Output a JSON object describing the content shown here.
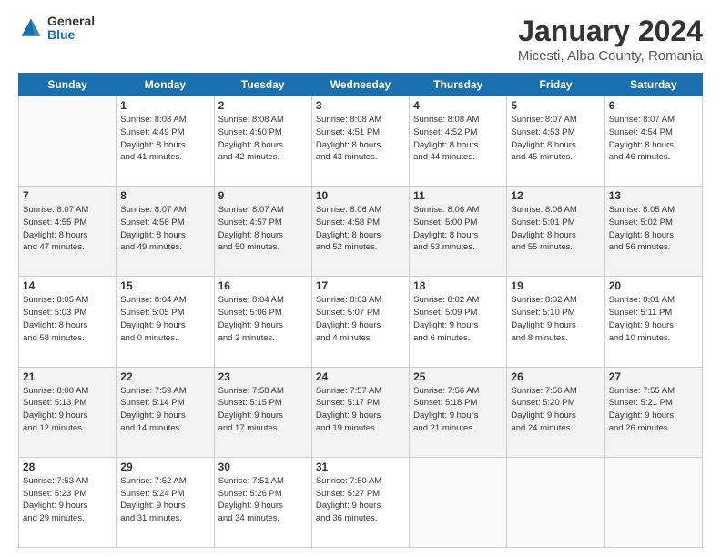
{
  "header": {
    "logo": {
      "general": "General",
      "blue": "Blue"
    },
    "title": "January 2024",
    "subtitle": "Micesti, Alba County, Romania"
  },
  "calendar": {
    "days_of_week": [
      "Sunday",
      "Monday",
      "Tuesday",
      "Wednesday",
      "Thursday",
      "Friday",
      "Saturday"
    ],
    "weeks": [
      [
        {
          "day": "",
          "empty": true
        },
        {
          "day": "1",
          "sunrise": "Sunrise: 8:08 AM",
          "sunset": "Sunset: 4:49 PM",
          "daylight": "Daylight: 8 hours and 41 minutes."
        },
        {
          "day": "2",
          "sunrise": "Sunrise: 8:08 AM",
          "sunset": "Sunset: 4:50 PM",
          "daylight": "Daylight: 8 hours and 42 minutes."
        },
        {
          "day": "3",
          "sunrise": "Sunrise: 8:08 AM",
          "sunset": "Sunset: 4:51 PM",
          "daylight": "Daylight: 8 hours and 43 minutes."
        },
        {
          "day": "4",
          "sunrise": "Sunrise: 8:08 AM",
          "sunset": "Sunset: 4:52 PM",
          "daylight": "Daylight: 8 hours and 44 minutes."
        },
        {
          "day": "5",
          "sunrise": "Sunrise: 8:07 AM",
          "sunset": "Sunset: 4:53 PM",
          "daylight": "Daylight: 8 hours and 45 minutes."
        },
        {
          "day": "6",
          "sunrise": "Sunrise: 8:07 AM",
          "sunset": "Sunset: 4:54 PM",
          "daylight": "Daylight: 8 hours and 46 minutes."
        }
      ],
      [
        {
          "day": "7",
          "sunrise": "Sunrise: 8:07 AM",
          "sunset": "Sunset: 4:55 PM",
          "daylight": "Daylight: 8 hours and 47 minutes."
        },
        {
          "day": "8",
          "sunrise": "Sunrise: 8:07 AM",
          "sunset": "Sunset: 4:56 PM",
          "daylight": "Daylight: 8 hours and 49 minutes."
        },
        {
          "day": "9",
          "sunrise": "Sunrise: 8:07 AM",
          "sunset": "Sunset: 4:57 PM",
          "daylight": "Daylight: 8 hours and 50 minutes."
        },
        {
          "day": "10",
          "sunrise": "Sunrise: 8:06 AM",
          "sunset": "Sunset: 4:58 PM",
          "daylight": "Daylight: 8 hours and 52 minutes."
        },
        {
          "day": "11",
          "sunrise": "Sunrise: 8:06 AM",
          "sunset": "Sunset: 5:00 PM",
          "daylight": "Daylight: 8 hours and 53 minutes."
        },
        {
          "day": "12",
          "sunrise": "Sunrise: 8:06 AM",
          "sunset": "Sunset: 5:01 PM",
          "daylight": "Daylight: 8 hours and 55 minutes."
        },
        {
          "day": "13",
          "sunrise": "Sunrise: 8:05 AM",
          "sunset": "Sunset: 5:02 PM",
          "daylight": "Daylight: 8 hours and 56 minutes."
        }
      ],
      [
        {
          "day": "14",
          "sunrise": "Sunrise: 8:05 AM",
          "sunset": "Sunset: 5:03 PM",
          "daylight": "Daylight: 8 hours and 58 minutes."
        },
        {
          "day": "15",
          "sunrise": "Sunrise: 8:04 AM",
          "sunset": "Sunset: 5:05 PM",
          "daylight": "Daylight: 9 hours and 0 minutes."
        },
        {
          "day": "16",
          "sunrise": "Sunrise: 8:04 AM",
          "sunset": "Sunset: 5:06 PM",
          "daylight": "Daylight: 9 hours and 2 minutes."
        },
        {
          "day": "17",
          "sunrise": "Sunrise: 8:03 AM",
          "sunset": "Sunset: 5:07 PM",
          "daylight": "Daylight: 9 hours and 4 minutes."
        },
        {
          "day": "18",
          "sunrise": "Sunrise: 8:02 AM",
          "sunset": "Sunset: 5:09 PM",
          "daylight": "Daylight: 9 hours and 6 minutes."
        },
        {
          "day": "19",
          "sunrise": "Sunrise: 8:02 AM",
          "sunset": "Sunset: 5:10 PM",
          "daylight": "Daylight: 9 hours and 8 minutes."
        },
        {
          "day": "20",
          "sunrise": "Sunrise: 8:01 AM",
          "sunset": "Sunset: 5:11 PM",
          "daylight": "Daylight: 9 hours and 10 minutes."
        }
      ],
      [
        {
          "day": "21",
          "sunrise": "Sunrise: 8:00 AM",
          "sunset": "Sunset: 5:13 PM",
          "daylight": "Daylight: 9 hours and 12 minutes."
        },
        {
          "day": "22",
          "sunrise": "Sunrise: 7:59 AM",
          "sunset": "Sunset: 5:14 PM",
          "daylight": "Daylight: 9 hours and 14 minutes."
        },
        {
          "day": "23",
          "sunrise": "Sunrise: 7:58 AM",
          "sunset": "Sunset: 5:15 PM",
          "daylight": "Daylight: 9 hours and 17 minutes."
        },
        {
          "day": "24",
          "sunrise": "Sunrise: 7:57 AM",
          "sunset": "Sunset: 5:17 PM",
          "daylight": "Daylight: 9 hours and 19 minutes."
        },
        {
          "day": "25",
          "sunrise": "Sunrise: 7:56 AM",
          "sunset": "Sunset: 5:18 PM",
          "daylight": "Daylight: 9 hours and 21 minutes."
        },
        {
          "day": "26",
          "sunrise": "Sunrise: 7:56 AM",
          "sunset": "Sunset: 5:20 PM",
          "daylight": "Daylight: 9 hours and 24 minutes."
        },
        {
          "day": "27",
          "sunrise": "Sunrise: 7:55 AM",
          "sunset": "Sunset: 5:21 PM",
          "daylight": "Daylight: 9 hours and 26 minutes."
        }
      ],
      [
        {
          "day": "28",
          "sunrise": "Sunrise: 7:53 AM",
          "sunset": "Sunset: 5:23 PM",
          "daylight": "Daylight: 9 hours and 29 minutes."
        },
        {
          "day": "29",
          "sunrise": "Sunrise: 7:52 AM",
          "sunset": "Sunset: 5:24 PM",
          "daylight": "Daylight: 9 hours and 31 minutes."
        },
        {
          "day": "30",
          "sunrise": "Sunrise: 7:51 AM",
          "sunset": "Sunset: 5:26 PM",
          "daylight": "Daylight: 9 hours and 34 minutes."
        },
        {
          "day": "31",
          "sunrise": "Sunrise: 7:50 AM",
          "sunset": "Sunset: 5:27 PM",
          "daylight": "Daylight: 9 hours and 36 minutes."
        },
        {
          "day": "",
          "empty": true
        },
        {
          "day": "",
          "empty": true
        },
        {
          "day": "",
          "empty": true
        }
      ]
    ]
  }
}
